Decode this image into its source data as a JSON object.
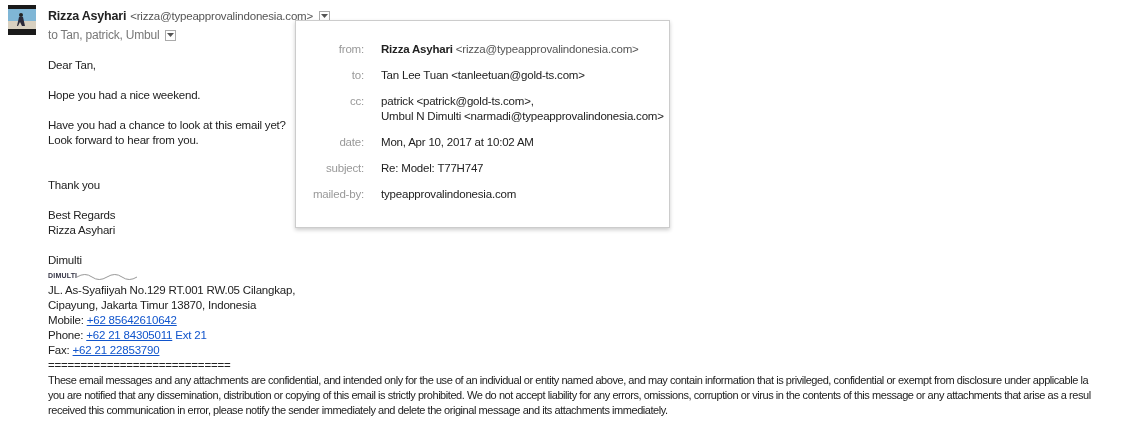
{
  "header": {
    "sender_name": "Rizza Asyhari",
    "sender_email": "<rizza@typeapprovalindonesia.com>",
    "recipients": "to Tan, patrick, Umbul"
  },
  "body": [
    {
      "lines": [
        "Dear Tan,"
      ]
    },
    {
      "lines": [
        "Hope you had a nice weekend."
      ]
    },
    {
      "lines": [
        "Have you had a chance to look at this email yet?",
        "Look forward to hear from you."
      ]
    },
    {
      "kind": "closing",
      "lines": [
        "Thank you"
      ]
    },
    {
      "lines": [
        "Best Regards",
        "Rizza Asyhari"
      ]
    }
  ],
  "signature": {
    "company": "Dimulti",
    "logo_text": "DIMULTI",
    "address": [
      "JL. As-Syafiiyah No.129 RT.001 RW.05 Cilangkap,",
      "Cipayung, Jakarta Timur 13870, Indonesia"
    ],
    "contacts": [
      {
        "label": "Mobile:",
        "number": "+62 85642610642"
      },
      {
        "label": "Phone:",
        "number": "+62 21 84305011",
        "suffix": "Ext 21"
      },
      {
        "label": "Fax:",
        "number": "+62 21 22853790"
      }
    ],
    "separator": "============================",
    "disclaimer": [
      "These email messages and any attachments are confidential, and intended only for the use of an individual or entity named above, and may contain information that is privileged, confidential or exempt from disclosure under applicable la",
      "you are notified that any dissemination, distribution or copying of this email is strictly prohibited. We do not accept liability for any errors, omissions, corruption or virus in the contents of this message or any attachments that arise as a resul",
      "received this communication in error, please notify the sender immediately and delete the original message and its attachments immediately."
    ]
  },
  "details": [
    {
      "label": "from:",
      "name": "Rizza Asyhari",
      "value": [
        "<rizza@typeapprovalindonesia.com>"
      ]
    },
    {
      "label": "to:",
      "value": [
        "Tan Lee Tuan <tanleetuan@gold-ts.com>"
      ]
    },
    {
      "label": "cc:",
      "value": [
        "patrick <patrick@gold-ts.com>,",
        "Umbul N Dimulti <narmadi@typeapprovalindonesia.com>"
      ]
    },
    {
      "label": "date:",
      "value": [
        "Mon, Apr 10, 2017 at 10:02 AM"
      ]
    },
    {
      "label": "subject:",
      "value": [
        "Re: Model: T77H747"
      ]
    },
    {
      "label": "mailed-by:",
      "value": [
        "typeapprovalindonesia.com"
      ]
    }
  ]
}
